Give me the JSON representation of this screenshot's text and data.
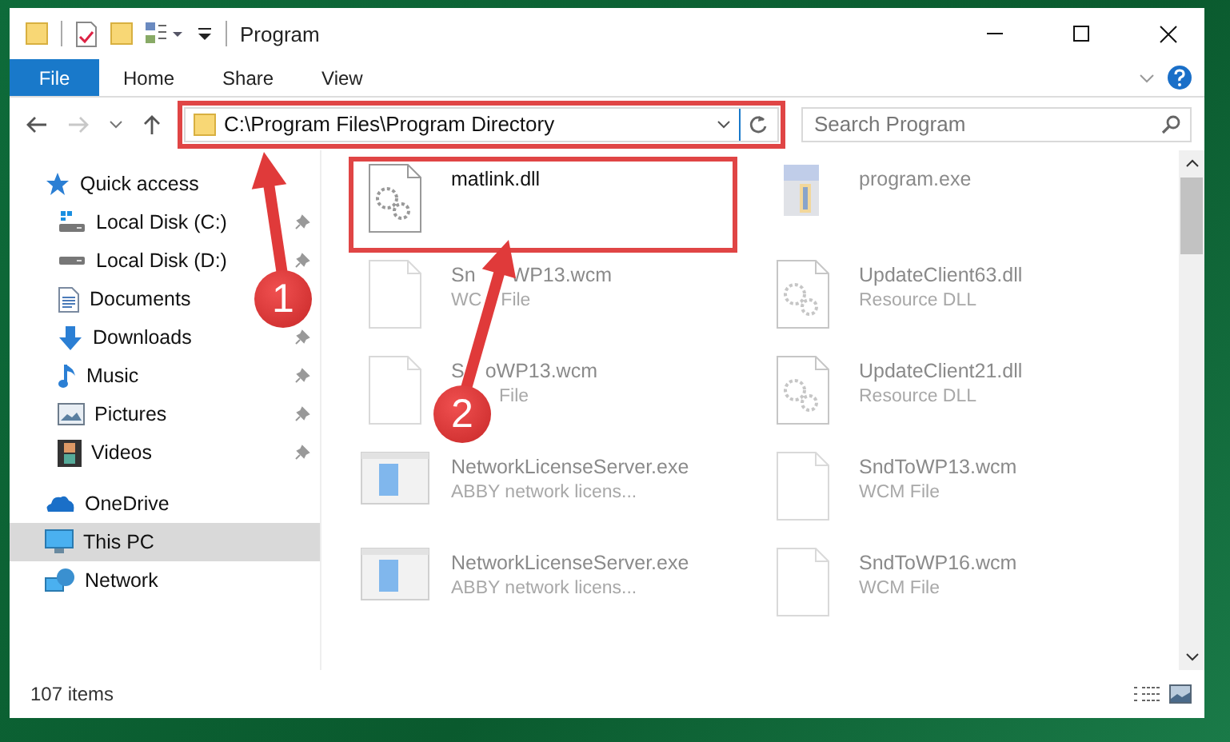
{
  "window": {
    "title": "Program"
  },
  "ribbon_tabs": [
    {
      "label": "File",
      "kind": "file"
    },
    {
      "label": "Home",
      "kind": "tab"
    },
    {
      "label": "Share",
      "kind": "tab"
    },
    {
      "label": "View",
      "kind": "tab"
    }
  ],
  "address": {
    "path": "C:\\Program Files\\Program Directory",
    "highlighted": true
  },
  "search": {
    "placeholder": "Search Program"
  },
  "sidebar": {
    "items": [
      {
        "label": "Quick access",
        "children": [
          {
            "label": "Local Disk (C:)",
            "pinned": true
          },
          {
            "label": "Local Disk (D:)",
            "pinned": true
          },
          {
            "label": "Documents",
            "pinned": false
          },
          {
            "label": "Downloads",
            "pinned": true
          },
          {
            "label": "Music",
            "pinned": true
          },
          {
            "label": "Pictures",
            "pinned": true
          },
          {
            "label": "Videos",
            "pinned": true
          }
        ]
      },
      {
        "label": "OneDrive",
        "selected": false
      },
      {
        "label": "This PC",
        "selected": true
      },
      {
        "label": "Network",
        "selected": false
      }
    ]
  },
  "files": [
    {
      "name_parts": [
        "matlink.dll"
      ],
      "blurred": false,
      "highlighted": true
    },
    {
      "name_parts": [
        "program.exe"
      ],
      "blurred": true,
      "highlighted": false
    },
    {
      "name_parts": [
        "Sn",
        "WP13.wcm"
      ],
      "type_parts": [
        "WC",
        "File"
      ],
      "blurred": true,
      "highlighted": false
    },
    {
      "name_parts": [
        "UpdateClient63.dll"
      ],
      "type_parts": [
        "Resource DLL"
      ],
      "blurred": true,
      "highlighted": false
    },
    {
      "name_parts": [
        "S",
        "oWP13.wcm"
      ],
      "type_parts": [
        "File"
      ],
      "blurred": true,
      "highlighted": false
    },
    {
      "name_parts": [
        "UpdateClient21.dll"
      ],
      "type_parts": [
        "Resource DLL"
      ],
      "blurred": true,
      "highlighted": false
    },
    {
      "name_parts": [
        "NetworkLicenseServer.exe"
      ],
      "type_parts": [
        "ABBY network licens..."
      ],
      "blurred": true,
      "highlighted": false
    },
    {
      "name_parts": [
        "SndToWP13.wcm"
      ],
      "type_parts": [
        "WCM File"
      ],
      "blurred": true,
      "highlighted": false
    },
    {
      "name_parts": [
        "NetworkLicenseServer.exe"
      ],
      "type_parts": [
        "ABBY network licens..."
      ],
      "blurred": true,
      "highlighted": false
    },
    {
      "name_parts": [
        "SndToWP16.wcm"
      ],
      "type_parts": [
        "WCM File"
      ],
      "blurred": true,
      "highlighted": false
    }
  ],
  "status_bar": {
    "count": "107 items"
  },
  "annotations": [
    {
      "kind": "arrow",
      "label": "1"
    },
    {
      "kind": "arrow",
      "label": "2"
    }
  ]
}
